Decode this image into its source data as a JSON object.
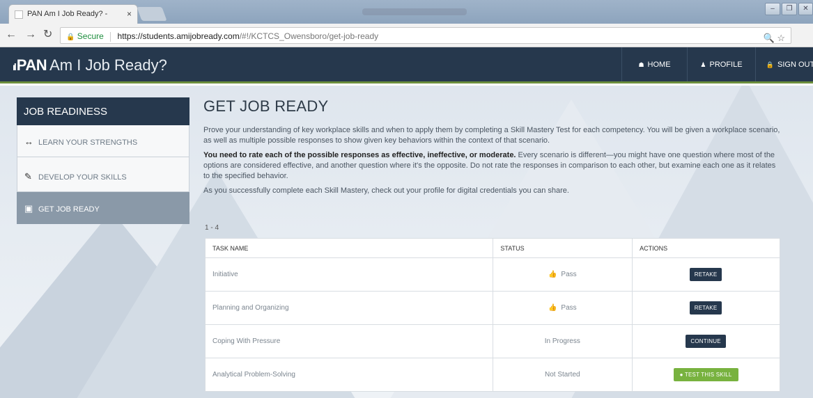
{
  "browser": {
    "tab_title": "PAN Am I Job Ready? -",
    "tab_close": "×",
    "secure_label": "Secure",
    "url_host": "https://students.amijobready.com",
    "url_path": "/#!/KCTCS_Owensboro/get-job-ready"
  },
  "header": {
    "logo": "PAN",
    "app_name": "Am I Job Ready?",
    "nav": [
      {
        "label": "HOME",
        "icon": "home-icon"
      },
      {
        "label": "PROFILE",
        "icon": "user-icon"
      },
      {
        "label": "SIGN OUT",
        "icon": "lock-icon"
      }
    ]
  },
  "sidebar": {
    "title": "JOB READINESS",
    "items": [
      {
        "label": "LEARN YOUR STRENGTHS",
        "icon": "arrows-icon"
      },
      {
        "label": "DEVELOP YOUR SKILLS",
        "icon": "pencil-icon"
      },
      {
        "label": "GET JOB READY",
        "icon": "briefcase-icon",
        "active": true
      }
    ]
  },
  "main": {
    "title": "GET JOB READY",
    "para1": "Prove your understanding of key workplace skills and when to apply them by completing a Skill Mastery Test for each competency. You will be given a workplace scenario, as well as multiple possible responses to show given key behaviors within the context of that scenario.",
    "para2_bold": "You need to rate each of the possible responses as effective, ineffective, or moderate.",
    "para2_rest": " Every scenario is different—you might have one question where most of the options are considered effective, and another question where it's the opposite. Do not rate the responses in comparison to each other, but examine each one as it relates to the specified behavior.",
    "para3": "As you successfully complete each Skill Mastery, check out your profile for digital credentials you can share.",
    "range": "1 - 4",
    "table": {
      "headers": [
        "TASK NAME",
        "STATUS",
        "ACTIONS"
      ],
      "rows": [
        {
          "task": "Initiative",
          "status": "Pass",
          "action": "RETAKE"
        },
        {
          "task": "Planning and Organizing",
          "status": "Pass",
          "action": "RETAKE"
        },
        {
          "task": "Coping With Pressure",
          "status": "In Progress",
          "action": "CONTINUE"
        },
        {
          "task": "Analytical Problem-Solving",
          "status": "Not Started",
          "action": "TEST THIS SKILL"
        }
      ]
    }
  },
  "colors": {
    "header_bg": "#26384d",
    "accent_green": "#78b23f",
    "sidebar_active": "#8a99a8"
  }
}
